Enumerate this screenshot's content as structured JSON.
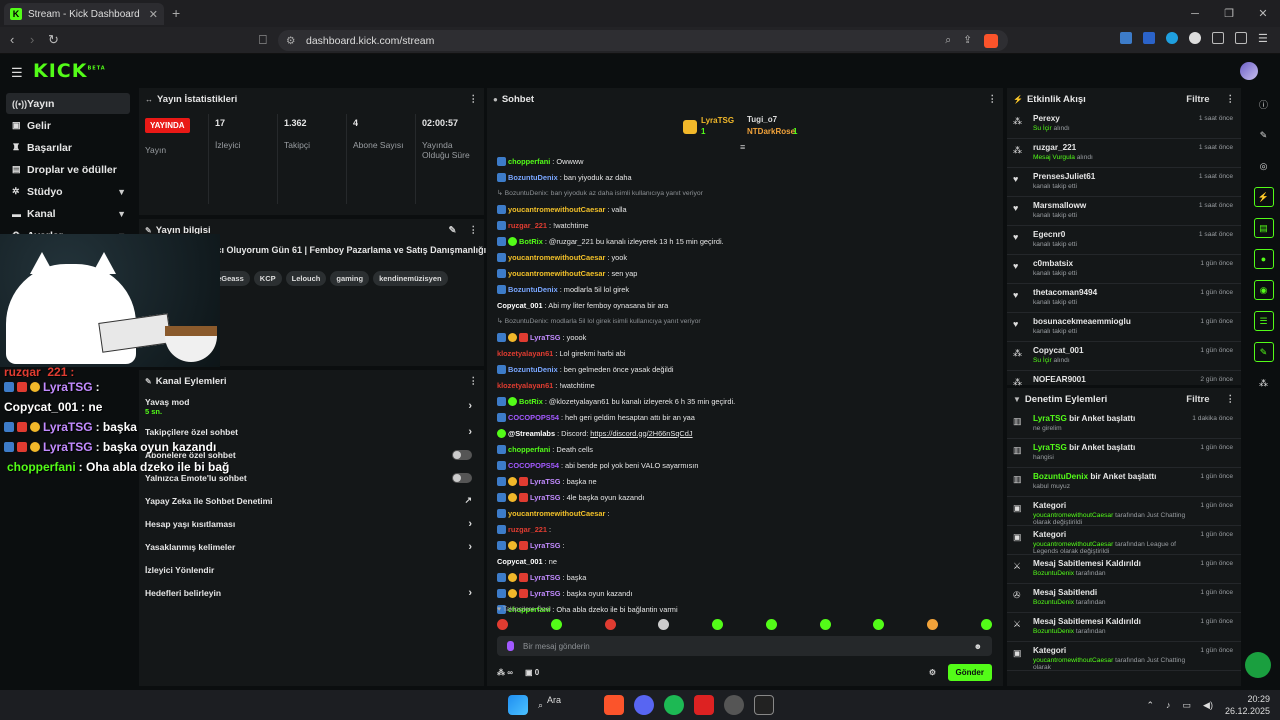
{
  "browser": {
    "tab_title": "Stream - Kick Dashboard",
    "tab_favicon": "K",
    "url": "dashboard.kick.com/stream"
  },
  "header": {
    "logo": "KICK",
    "logo_badge": "BETA"
  },
  "sidebar": {
    "items": [
      {
        "label": "Yayın",
        "icon": "broadcast-icon",
        "active": true
      },
      {
        "label": "Gelir",
        "icon": "wallet-icon"
      },
      {
        "label": "Başarılar",
        "icon": "trophy-icon"
      },
      {
        "label": "Droplar ve ödüller",
        "icon": "gift-icon"
      },
      {
        "label": "Stüdyo",
        "icon": "studio-icon",
        "chevron": true
      },
      {
        "label": "Kanal",
        "icon": "channel-icon",
        "chevron": true
      },
      {
        "label": "Ayarlar",
        "icon": "gear-icon",
        "chevron": true
      }
    ]
  },
  "stats": {
    "title": "Yayın İstatistikleri",
    "live_badge": "YAYINDA",
    "items": [
      {
        "value": "",
        "label": "Yayın"
      },
      {
        "value": "17",
        "label": "İzleyici"
      },
      {
        "value": "1.362",
        "label": "Takipçi"
      },
      {
        "value": "4",
        "label": "Abone Sayısı"
      },
      {
        "value": "02:00:57",
        "label": "Yayında Olduğu Süre"
      }
    ]
  },
  "streaminfo": {
    "title": "Yayın bilgisi",
    "stream_title": "ncı Oluyorum Gün 61 | Femboy Pazarlama ve Satış Danışmanlığı A.Ş",
    "stream_title_2": "t",
    "tags": [
      "leGeass",
      "KCP",
      "Lelouch",
      "gaming",
      "kendinemüzisyen"
    ]
  },
  "overlay_chat": [
    {
      "user": "ruzgar_221",
      "text": ":",
      "color": "#e03c31"
    },
    {
      "user": "LyraTSG",
      "text": ":",
      "color": "#a259ff"
    },
    {
      "user": "Copycat_001",
      "text": ": ne",
      "color": "#ffffff"
    },
    {
      "user": "LyraTSG",
      "text": ": başka",
      "color": "#a259ff"
    },
    {
      "user": "LyraTSG",
      "text": ": başka oyun kazandı",
      "color": "#a259ff"
    },
    {
      "user": "chopperfani",
      "text": ": Oha abla dzeko ile bi bağ",
      "color": "#53fc18"
    }
  ],
  "channel_actions": {
    "title": "Kanal Eylemleri",
    "items": [
      {
        "label": "Yavaş mod",
        "sub": "5 sn.",
        "control": "arrow"
      },
      {
        "label": "Takipçilere özel sohbet",
        "control": "arrow"
      },
      {
        "label": "Abonelere özel sohbet",
        "control": "toggle"
      },
      {
        "label": "Yalnızca Emote'lu sohbet",
        "control": "toggle"
      },
      {
        "label": "Yapay Zeka ile Sohbet Denetimi",
        "control": "link"
      },
      {
        "label": "Hesap yaşı kısıtlaması",
        "control": "arrow"
      },
      {
        "label": "Yasaklanmış kelimeler",
        "control": "arrow"
      },
      {
        "label": "İzleyici Yönlendir",
        "control": "none"
      },
      {
        "label": "Hedefleri belirleyin",
        "control": "arrow"
      }
    ]
  },
  "chat": {
    "title": "Sohbet",
    "pinned": [
      {
        "user": "LyraTSG",
        "count": "1"
      },
      {
        "user": "Tugi_o7",
        "count": ""
      },
      {
        "user": "NTDarkRose",
        "count": "1"
      }
    ],
    "messages": [
      {
        "icons": [
          "b"
        ],
        "user": "chopperfani",
        "color": "#53fc18",
        "text": ": Owwww"
      },
      {
        "icons": [
          "b"
        ],
        "user": "BozuntuDenix",
        "color": "#79a6ff",
        "text": ": ban yiyoduk az daha"
      },
      {
        "reply": "BozuntuDenix: ban yiyoduk az daha isimli kullanıcıya yanıt veriyor"
      },
      {
        "icons": [
          "b"
        ],
        "user": "youcantromewithoutCaesar",
        "color": "#f2c029",
        "text": ": valla"
      },
      {
        "icons": [
          "b"
        ],
        "user": "ruzgar_221",
        "color": "#e03c31",
        "text": ": !watchtime"
      },
      {
        "icons": [
          "b",
          "g"
        ],
        "user": "BotRix",
        "color": "#53fc18",
        "text": ": @ruzgar_221 bu kanalı izleyerek 13 h 15 min geçirdi."
      },
      {
        "icons": [
          "b"
        ],
        "user": "youcantromewithoutCaesar",
        "color": "#f2c029",
        "text": ": yook"
      },
      {
        "icons": [
          "b"
        ],
        "user": "youcantromewithoutCaesar",
        "color": "#f2c029",
        "text": ": sen yap"
      },
      {
        "icons": [
          "b"
        ],
        "user": "BozuntuDenix",
        "color": "#79a6ff",
        "text": ": modlarla 5il lol girek"
      },
      {
        "icons": [],
        "user": "Copycat_001",
        "color": "#ffffff",
        "text": ": Abi my liter femboy oynasana bir ara"
      },
      {
        "reply": "BozuntuDenix: modlarla 5il lol girek isimli kullanıcıya yanıt veriyor"
      },
      {
        "icons": [
          "b",
          "y",
          "r"
        ],
        "user": "LyraTSG",
        "color": "#c28bff",
        "text": ": yoook"
      },
      {
        "icons": [],
        "user": "klozetyalayan61",
        "color": "#e03c31",
        "text": ": Lol girekmi harbi abi"
      },
      {
        "icons": [
          "b"
        ],
        "user": "BozuntuDenix",
        "color": "#79a6ff",
        "text": ": ben gelmeden önce yasak değildi"
      },
      {
        "icons": [],
        "user": "klozetyalayan61",
        "color": "#e03c31",
        "text": ": !watchtime"
      },
      {
        "icons": [
          "b",
          "g"
        ],
        "user": "BotRix",
        "color": "#53fc18",
        "text": ": @klozetyalayan61 bu kanalı izleyerek 6 h 35 min geçirdi."
      },
      {
        "icons": [
          "b"
        ],
        "user": "COCOPOPS54",
        "color": "#a259ff",
        "text": ": heh geri geldim hesaptan attı bir an yaa"
      },
      {
        "icons": [
          "g"
        ],
        "user": "@Streamlabs",
        "color": "#ffffff",
        "text": ": Discord: ",
        "link": "https://discord.gg/2H66nSqCdJ"
      },
      {
        "icons": [
          "b"
        ],
        "user": "chopperfani",
        "color": "#53fc18",
        "text": ": Death cells"
      },
      {
        "icons": [
          "b"
        ],
        "user": "COCOPOPS54",
        "color": "#a259ff",
        "text": ": abi bende pol yok beni VALO sayarmısın"
      },
      {
        "icons": [
          "b",
          "y",
          "r"
        ],
        "user": "LyraTSG",
        "color": "#c28bff",
        "text": ": başka ne"
      },
      {
        "icons": [
          "b",
          "y",
          "r"
        ],
        "user": "LyraTSG",
        "color": "#c28bff",
        "text": ": 4le başka oyun kazandı"
      },
      {
        "icons": [
          "b"
        ],
        "user": "youcantromewithoutCaesar",
        "color": "#f2c029",
        "text": ":"
      },
      {
        "icons": [
          "b"
        ],
        "user": "ruzgar_221",
        "color": "#e03c31",
        "text": ":"
      },
      {
        "icons": [
          "b",
          "y",
          "r"
        ],
        "user": "LyraTSG",
        "color": "#c28bff",
        "text": ":"
      },
      {
        "icons": [],
        "user": "Copycat_001",
        "color": "#ffffff",
        "text": ": ne"
      },
      {
        "icons": [
          "b",
          "y",
          "r"
        ],
        "user": "LyraTSG",
        "color": "#c28bff",
        "text": ": başka"
      },
      {
        "icons": [
          "b",
          "y",
          "r"
        ],
        "user": "LyraTSG",
        "color": "#c28bff",
        "text": ": başka oyun kazandı"
      },
      {
        "icons": [
          "b"
        ],
        "user": "chopperfani",
        "color": "#53fc18",
        "text": ": Oha abla dzeko ile bi bağlantin varmi"
      }
    ],
    "followers_only": "Takipçilere Özel",
    "input_placeholder": "Bir mesaj gönderin",
    "footer_count_1": "∞",
    "footer_count_2": "0",
    "send_label": "Gönder"
  },
  "events": {
    "title": "Etkinlik Akışı",
    "filter": "Filtre",
    "items": [
      {
        "user": "Perexy",
        "sub_hl": "Su İçir",
        "sub": "alındı",
        "time": "1 saat önce",
        "icon": "gift-icon"
      },
      {
        "user": "ruzgar_221",
        "sub_hl": "Mesaj Vurgula",
        "sub": "alındı",
        "time": "1 saat önce",
        "icon": "gift-icon"
      },
      {
        "user": "PrensesJuliet61",
        "sub_hl": "",
        "sub": "kanalı takip etti",
        "time": "1 saat önce",
        "icon": "heart-icon"
      },
      {
        "user": "Marsmalloww",
        "sub_hl": "",
        "sub": "kanalı takip etti",
        "time": "1 saat önce",
        "icon": "heart-icon"
      },
      {
        "user": "Egecnr0",
        "sub_hl": "",
        "sub": "kanalı takip etti",
        "time": "1 saat önce",
        "icon": "heart-icon"
      },
      {
        "user": "c0mbatsix",
        "sub_hl": "",
        "sub": "kanalı takip etti",
        "time": "1 gün önce",
        "icon": "heart-icon"
      },
      {
        "user": "thetacoman9494",
        "sub_hl": "",
        "sub": "kanalı takip etti",
        "time": "1 gün önce",
        "icon": "heart-icon"
      },
      {
        "user": "bosunacekmeaemmioglu",
        "sub_hl": "",
        "sub": "kanalı takip etti",
        "time": "1 gün önce",
        "icon": "heart-icon"
      },
      {
        "user": "Copycat_001",
        "sub_hl": "Su İçir",
        "sub": "alındı",
        "time": "1 gün önce",
        "icon": "gift-icon"
      },
      {
        "user": "NOFEAR9001",
        "sub_hl": "",
        "sub": "",
        "time": "2 gün önce",
        "icon": "gift-icon"
      }
    ]
  },
  "audit": {
    "title": "Denetim Eylemleri",
    "filter": "Filtre",
    "items": [
      {
        "hl": "LyraTSG",
        "title": "bir Anket başlattı",
        "sub": "ne girelim",
        "time": "1 dakika önce",
        "icon": "poll-icon"
      },
      {
        "hl": "LyraTSG",
        "title": "bir Anket başlattı",
        "sub": "hangisi",
        "time": "1 gün önce",
        "icon": "poll-icon"
      },
      {
        "hl": "BozuntuDenix",
        "title": "bir Anket başlattı",
        "sub": "kabul muyuz",
        "time": "1 gün önce",
        "icon": "poll-icon"
      },
      {
        "hl": "",
        "title": "Kategori",
        "sub_hl": "youcantromewithoutCaesar",
        "sub": "tarafından Just Chatting olarak değiştirildi",
        "time": "1 gün önce",
        "icon": "category-icon"
      },
      {
        "hl": "",
        "title": "Kategori",
        "sub_hl": "youcantromewithoutCaesar",
        "sub": "tarafından League of Legends olarak değiştirildi",
        "time": "1 gün önce",
        "icon": "category-icon"
      },
      {
        "hl": "",
        "title": "Mesaj Sabitlemesi Kaldırıldı",
        "sub_hl": "BozuntuDenix",
        "sub": "tarafından",
        "time": "1 gün önce",
        "icon": "unpin-icon"
      },
      {
        "hl": "",
        "title": "Mesaj Sabitlendi",
        "sub_hl": "BozuntuDenix",
        "sub": "tarafından",
        "time": "1 gün önce",
        "icon": "pin-icon"
      },
      {
        "hl": "",
        "title": "Mesaj Sabitlemesi Kaldırıldı",
        "sub_hl": "BozuntuDenix",
        "sub": "tarafından",
        "time": "1 gün önce",
        "icon": "unpin-icon"
      },
      {
        "hl": "",
        "title": "Kategori",
        "sub_hl": "youcantromewithoutCaesar",
        "sub": "tarafından Just Chatting olarak",
        "time": "1 gün önce",
        "icon": "category-icon"
      }
    ]
  },
  "taskbar": {
    "search": "Ara",
    "time": "20:29",
    "date": "26.12.2025"
  },
  "colors": {
    "accent": "#53fc18",
    "live": "#e91916",
    "panel": "#141718",
    "bg": "#0b0e0f"
  }
}
